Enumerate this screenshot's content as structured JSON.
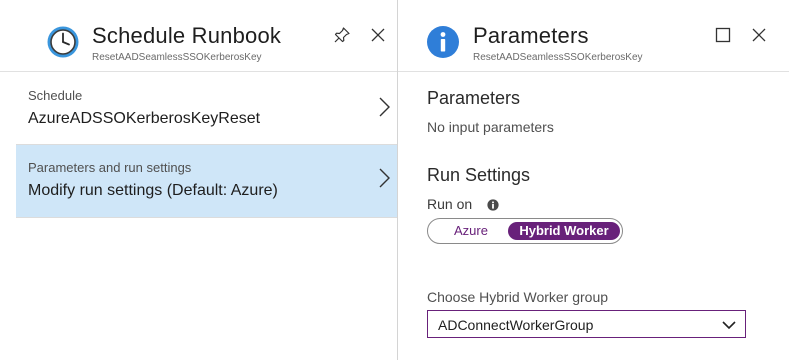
{
  "left_blade": {
    "title": "Schedule Runbook",
    "subtitle": "ResetAADSeamlessSSOKerberosKey",
    "header_icon": "clock-icon",
    "pin_icon": "pin-icon",
    "close_icon": "close-icon",
    "items": [
      {
        "label": "Schedule",
        "value": "AzureADSSOKerberosKeyReset",
        "selected": false
      },
      {
        "label": "Parameters and run settings",
        "value": "Modify run settings (Default: Azure)",
        "selected": true
      }
    ]
  },
  "right_blade": {
    "title": "Parameters",
    "subtitle": "ResetAADSeamlessSSOKerberosKey",
    "header_icon": "info-icon",
    "maximize_icon": "maximize-icon",
    "close_icon": "close-icon",
    "parameters_heading": "Parameters",
    "parameters_text": "No input parameters",
    "run_settings_heading": "Run Settings",
    "run_on_label": "Run on",
    "run_on_options": [
      "Azure",
      "Hybrid Worker"
    ],
    "run_on_selected": "Hybrid Worker",
    "worker_group_label": "Choose Hybrid Worker group",
    "worker_group_value": "ADConnectWorkerGroup"
  },
  "colors": {
    "accent_purple": "#68217a",
    "selected_bg": "#cfe6f8",
    "icon_blue": "#2f7ed8"
  }
}
